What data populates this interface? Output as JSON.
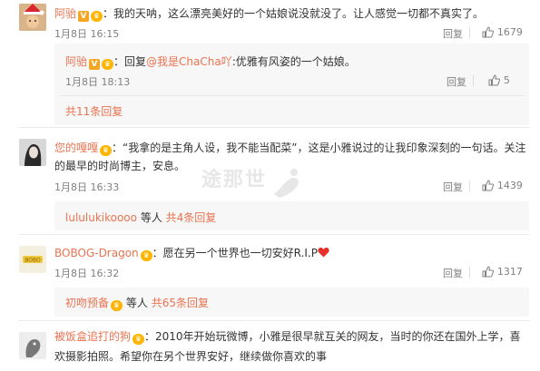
{
  "comments": [
    {
      "name": "阿骀",
      "text": "：我的天呐，这么漂亮美好的一个姑娘说没就没了。让人感觉一切都不真实了。",
      "time": "1月8日 16:15",
      "reply_label": "回复",
      "likes": "1679",
      "sub_reply": {
        "name": "阿骀",
        "text_prefix": "：回复",
        "mention": "@我是ChaCha吖",
        "text": ":优雅有风姿的一个姑娘。",
        "time": "1月8日 18:13",
        "reply_label": "回复",
        "likes": "5"
      },
      "more_replies": "共11条回复"
    },
    {
      "name": "您的嘎嘎",
      "text_line1": "：“我拿的是主角人设，我不能当配菜”，这是小雅说过的让我印象深刻的一句话。关注",
      "text_line2": "的最早的时尚博主，安息。",
      "time": "1月8日 16:33",
      "reply_label": "回复",
      "likes": "1439",
      "replier": "lululukikoooo",
      "replier_suffix": "等人",
      "more_replies": "共4条回复"
    },
    {
      "name": "BOBOG-Dragon",
      "text": "：愿在另一个世界也一切安好R.I.P",
      "time": "1月8日 16:32",
      "reply_label": "回复",
      "likes": "1317",
      "replier": "初吻预备",
      "replier_suffix": "等人",
      "more_replies": "共65条回复"
    },
    {
      "name": "被饭盒追打的狗",
      "text_line1": "：2010年开始玩微博，小雅是很早就互关的网友，当时的你还在国外上学，喜",
      "text_line2": "欢摄影拍照。希望你在另个世界安好，继续做你喜欢的事"
    }
  ],
  "watermark": "途那世",
  "colors": {
    "accent": "#eb7350",
    "meta": "#808080",
    "heart": "#e8302a"
  }
}
